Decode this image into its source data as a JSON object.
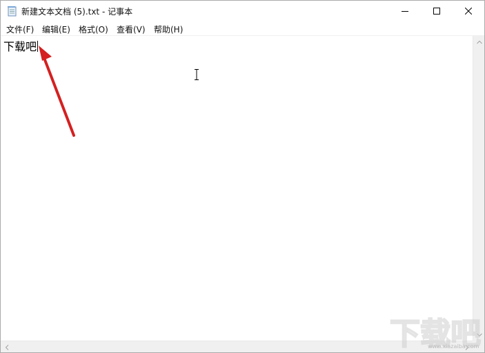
{
  "window": {
    "title": "新建文本文档 (5).txt - 记事本"
  },
  "menu": {
    "items": [
      {
        "label": "文件(F)"
      },
      {
        "label": "编辑(E)"
      },
      {
        "label": "格式(O)"
      },
      {
        "label": "查看(V)"
      },
      {
        "label": "帮助(H)"
      }
    ]
  },
  "editor": {
    "content": "下载吧"
  },
  "watermark": {
    "text": "下载吧",
    "url": "www.xiazaiba.com"
  },
  "colors": {
    "annotation_arrow": "#d42020",
    "window_bg": "#ffffff",
    "scrollbar_bg": "#f0f0f0"
  },
  "icons": {
    "app": "notepad-icon",
    "minimize": "minimize-icon",
    "maximize": "maximize-icon",
    "close": "close-icon"
  }
}
